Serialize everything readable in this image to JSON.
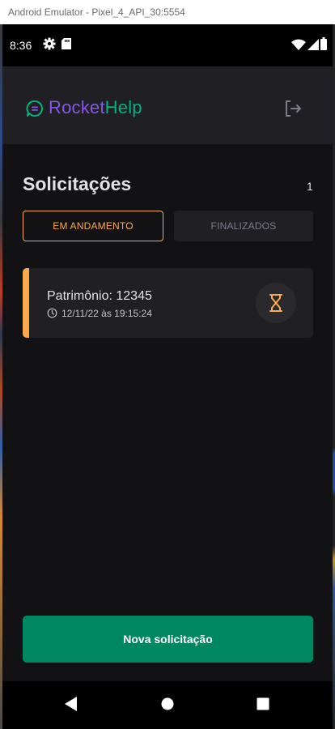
{
  "window": {
    "title": "Android Emulator - Pixel_4_API_30:5554"
  },
  "status_bar": {
    "time": "8:36",
    "icons": [
      "gear-icon",
      "sd-card-icon",
      "wifi-icon",
      "cellular-icon",
      "battery-icon"
    ]
  },
  "header": {
    "logo_part1": "Rocket",
    "logo_part2": "Help",
    "logo_icon": "chat-bubble-icon",
    "logout_icon": "logout-icon"
  },
  "main": {
    "title": "Solicitações",
    "count": "1",
    "filters": [
      {
        "label": "EM ANDAMENTO",
        "active": true
      },
      {
        "label": "FINALIZADOS",
        "active": false
      }
    ],
    "orders": [
      {
        "patrimony": "Patrimônio: 12345",
        "datetime": "12/11/22 às 19:15:24",
        "status_icon": "hourglass-icon",
        "status": "open"
      }
    ],
    "new_button": "Nova solicitação"
  },
  "nav_bar": {
    "icons": [
      "back-icon",
      "home-icon",
      "recents-icon"
    ]
  },
  "colors": {
    "purple": "#8257e5",
    "green": "#00b37e",
    "orange": "#fba94c",
    "button_green": "#00875f",
    "background": "#121214",
    "surface": "#202024"
  }
}
